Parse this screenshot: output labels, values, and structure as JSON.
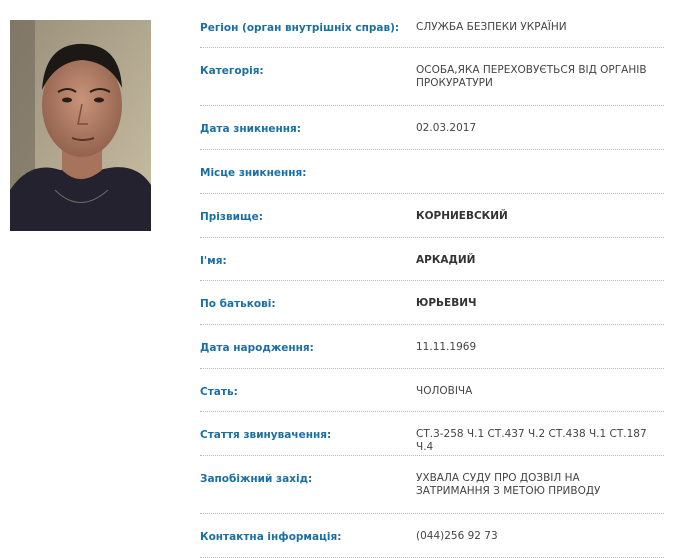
{
  "photo": {
    "icon": "person-photo"
  },
  "fields": [
    {
      "label": "Регіон (орган внутрішніх справ):",
      "value": "СЛУЖБА БЕЗПЕКИ УКРАЇНИ",
      "bold": false,
      "slug": "region"
    },
    {
      "label": "Категорія:",
      "value": "ОСОБА,ЯКА ПЕРЕХОВУЄТЬСЯ ВІД ОРГАНІВ ПРОКУРАТУРИ",
      "bold": false,
      "slug": "category"
    },
    {
      "label": "Дата зникнення:",
      "value": "02.03.2017",
      "bold": false,
      "slug": "disappearance-date"
    },
    {
      "label": "Місце зникнення:",
      "value": "",
      "bold": false,
      "slug": "disappearance-place"
    },
    {
      "label": "Прізвище:",
      "value": "КОРНИЕВСКИЙ",
      "bold": true,
      "slug": "surname"
    },
    {
      "label": "І'мя:",
      "value": "АРКАДИЙ",
      "bold": true,
      "slug": "first-name"
    },
    {
      "label": "По батькові:",
      "value": "ЮРЬЕВИЧ",
      "bold": true,
      "slug": "patronymic"
    },
    {
      "label": "Дата народження:",
      "value": "11.11.1969",
      "bold": false,
      "slug": "birth-date"
    },
    {
      "label": "Стать:",
      "value": "ЧОЛОВІЧА",
      "bold": false,
      "slug": "sex"
    },
    {
      "label": "Стаття звинувачення:",
      "value": "СТ.3-258 Ч.1 СТ.437 Ч.2 СТ.438 Ч.1 СТ.187 Ч.4",
      "bold": false,
      "slug": "charge-article"
    },
    {
      "label": "Запобіжний захід:",
      "value": "УХВАЛА СУДУ ПРО ДОЗВІЛ НА ЗАТРИМАННЯ З МЕТОЮ ПРИВОДУ",
      "bold": false,
      "slug": "preventive-measure"
    },
    {
      "label": "Контактна інформація:",
      "value": "(044)256 92 73",
      "bold": false,
      "slug": "contact-info"
    }
  ]
}
